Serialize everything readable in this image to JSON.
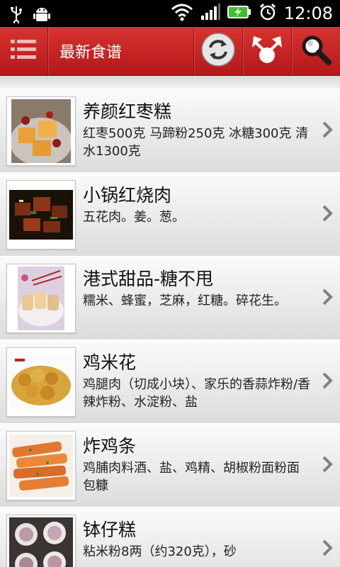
{
  "statusbar": {
    "time": "12:08",
    "icons": [
      "usb-icon",
      "android-debug-icon",
      "wifi-icon",
      "signal-icon",
      "battery-charging-icon",
      "alarm-icon"
    ]
  },
  "appbar": {
    "title": "最新食谱",
    "color": "#c1231f",
    "actions": [
      "menu-icon",
      "refresh-icon",
      "share-icon",
      "search-icon"
    ]
  },
  "recipes": [
    {
      "title": "养颜红枣糕",
      "ingredients": "红枣500克 马蹄粉250克 冰糖300克 清水1300克",
      "thumb": "jujube-cake-photo"
    },
    {
      "title": "小锅红烧肉",
      "ingredients": "五花肉。姜。葱。",
      "thumb": "braised-pork-photo"
    },
    {
      "title": "港式甜品-糖不甩",
      "ingredients": "糯米、蜂蜜，芝麻，红糖。碎花生。",
      "thumb": "glutinous-rice-dessert-photo"
    },
    {
      "title": "鸡米花",
      "ingredients": "鸡腿肉（切成小块）、家乐的香蒜炸粉/香辣炸粉、水淀粉、盐",
      "thumb": "popcorn-chicken-photo"
    },
    {
      "title": "炸鸡条",
      "ingredients": "鸡脯肉料酒、盐、鸡精、胡椒粉面粉面包糠",
      "thumb": "fried-chicken-strips-photo"
    },
    {
      "title": "钵仔糕",
      "ingredients": "粘米粉8两（约320克），砂",
      "thumb": "bowl-cake-photo"
    }
  ]
}
